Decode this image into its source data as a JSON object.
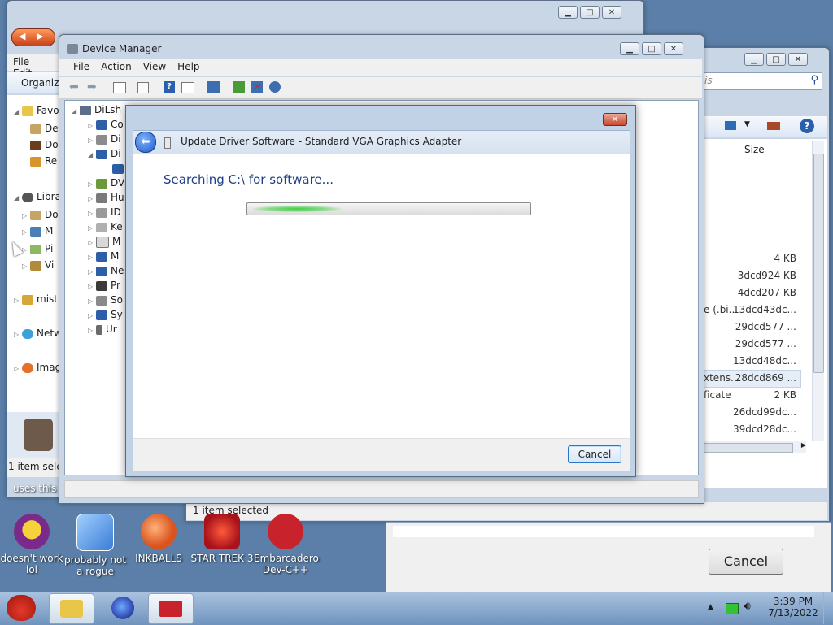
{
  "explorer_back": {
    "menu": [
      "File",
      "Edit"
    ],
    "organize_label": "Organize",
    "nav": [
      {
        "label": "Favo",
        "icon": "star-icon"
      },
      {
        "label": "De",
        "icon": "folder-icon"
      },
      {
        "label": "Do",
        "icon": "folder-icon"
      },
      {
        "label": "Re",
        "icon": "folder-icon"
      },
      {
        "label": "Libra",
        "icon": "library-icon"
      },
      {
        "label": "Do",
        "icon": "folder-icon"
      },
      {
        "label": "M",
        "icon": "music-icon"
      },
      {
        "label": "Pi",
        "icon": "pictures-icon"
      },
      {
        "label": "Vi",
        "icon": "video-icon"
      },
      {
        "label": "mist",
        "icon": "homegroup-icon"
      },
      {
        "label": "Netw",
        "icon": "network-icon"
      },
      {
        "label": "Imag",
        "icon": "image-icon"
      }
    ],
    "status": "1 item selec"
  },
  "explorer_right": {
    "search_placeholder": "is",
    "size_header": "Size",
    "rows": [
      {
        "left": "",
        "size": "4 KB"
      },
      {
        "left": "",
        "size": "3dcd924 KB"
      },
      {
        "left": "",
        "size": "4dcd207 KB"
      },
      {
        "left": "e (.bi...",
        "size": "13dcd43dc..."
      },
      {
        "left": "",
        "size": "29dcd577 ..."
      },
      {
        "left": "",
        "size": "29dcd577 ..."
      },
      {
        "left": "",
        "size": "13dcd48dc..."
      },
      {
        "left": "xtens...",
        "size": "28dcd869 ..."
      },
      {
        "left": "ficate",
        "size": "2 KB"
      },
      {
        "left": "",
        "size": "26dcd99dc..."
      },
      {
        "left": "",
        "size": "39dcd28dc..."
      }
    ],
    "status": "1 item selected"
  },
  "device_manager": {
    "title": "Device Manager",
    "menu": [
      "File",
      "Action",
      "View",
      "Help"
    ],
    "tree": [
      {
        "label": "DiLsh",
        "icon": "computer-icon"
      },
      {
        "label": "Co",
        "icon": "computer-icon"
      },
      {
        "label": "Di",
        "icon": "disk-icon"
      },
      {
        "label": "Di",
        "icon": "display-icon"
      },
      {
        "label": "",
        "icon": "display-adapter-icon"
      },
      {
        "label": "DV",
        "icon": "dvd-icon"
      },
      {
        "label": "Hu",
        "icon": "hid-icon"
      },
      {
        "label": "ID",
        "icon": "ide-icon"
      },
      {
        "label": "Ke",
        "icon": "keyboard-icon"
      },
      {
        "label": "M",
        "icon": "mouse-icon"
      },
      {
        "label": "M",
        "icon": "monitor-icon"
      },
      {
        "label": "Ne",
        "icon": "network-adapter-icon"
      },
      {
        "label": "Pr",
        "icon": "processor-icon"
      },
      {
        "label": "So",
        "icon": "sound-icon"
      },
      {
        "label": "Sy",
        "icon": "system-icon"
      },
      {
        "label": "Ur",
        "icon": "usb-icon"
      }
    ]
  },
  "dialog": {
    "title": "Update Driver Software - Standard VGA Graphics Adapter",
    "status_text": "Searching C:\\ for software...",
    "progress": 0.35,
    "cancel_label": "Cancel"
  },
  "background_dialog": {
    "cancel_label": "Cancel"
  },
  "desktop": {
    "partial_label": "uses this",
    "icons": [
      {
        "label": "doesn't work lol",
        "icon": "yahoo-messenger-icon",
        "color": "#7b2a8c"
      },
      {
        "label": "probably not a rogue",
        "icon": "settings-app-icon",
        "color": "#3a7bd5"
      },
      {
        "label": "INKBALLS",
        "icon": "inkballs-icon",
        "color": "#d9541e"
      },
      {
        "label": "STAR TREK 3",
        "icon": "star-trek-icon",
        "color": "#a8121a"
      },
      {
        "label": "Embarcadero Dev-C++",
        "icon": "dev-cpp-icon",
        "color": "#c8232c"
      }
    ]
  },
  "taskbar": {
    "buttons": [
      {
        "icon": "angry-birds-icon"
      },
      {
        "icon": "explorer-folder-icon"
      },
      {
        "icon": "firefox-icon"
      },
      {
        "icon": "device-manager-toolbox-icon"
      }
    ],
    "time": "3:39 PM",
    "date": "7/13/2022"
  },
  "colors": {
    "accent_blue": "#0046d5",
    "dialog_heading": "#1e3f8a",
    "progress_green": "#3fcf3f",
    "desktop_bg": "#5b7fa8"
  }
}
